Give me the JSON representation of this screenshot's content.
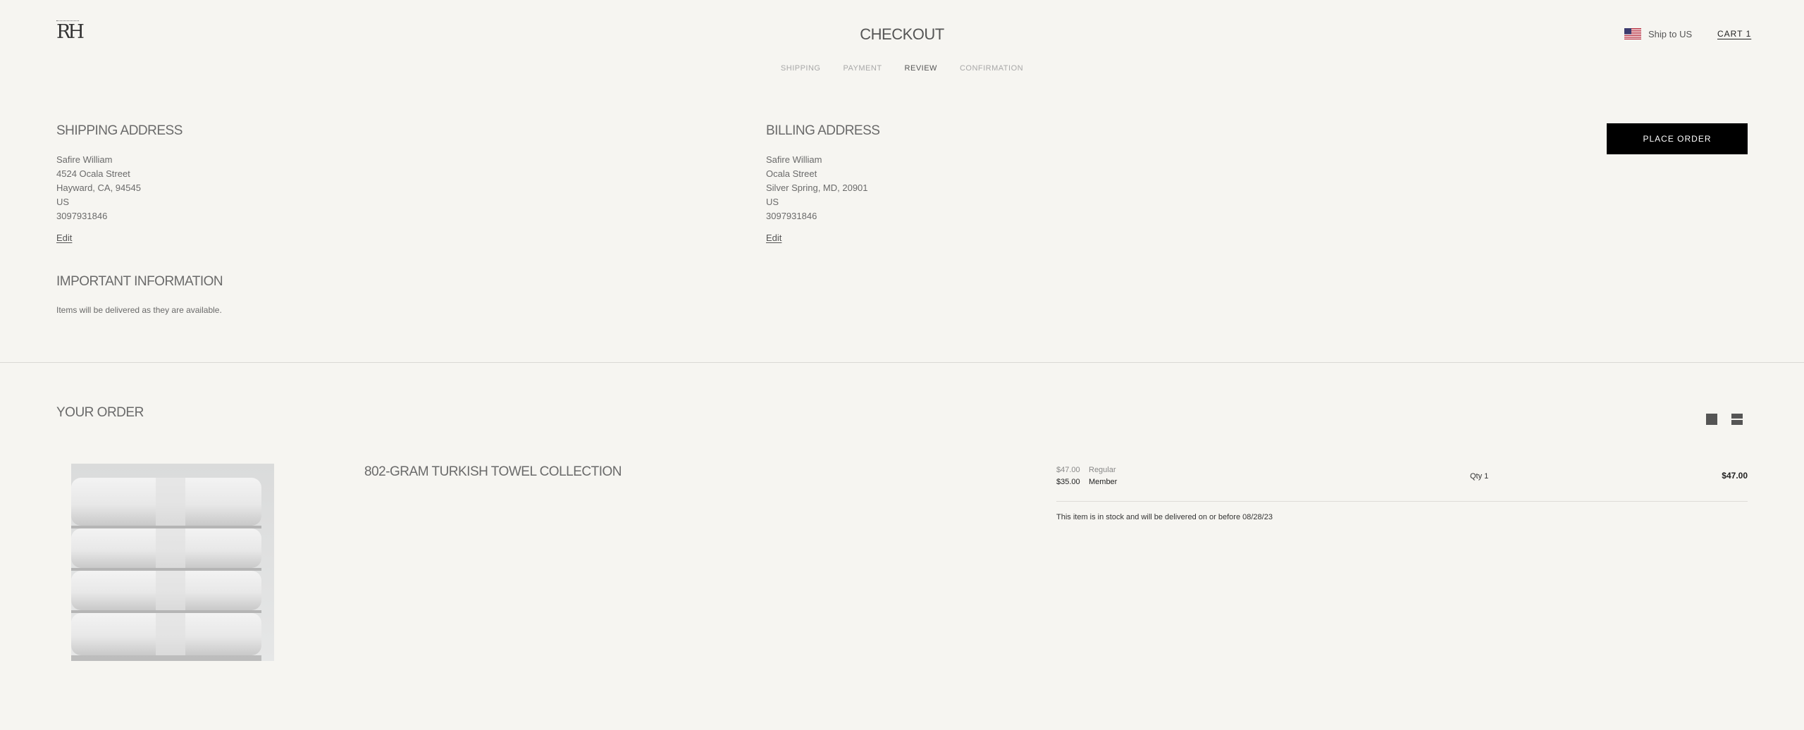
{
  "header": {
    "logo_text": "RH",
    "title": "CHECKOUT",
    "ship_to": "Ship to US",
    "cart": "CART 1"
  },
  "steps": [
    {
      "label": "SHIPPING",
      "active": false
    },
    {
      "label": "PAYMENT",
      "active": false
    },
    {
      "label": "REVIEW",
      "active": true
    },
    {
      "label": "CONFIRMATION",
      "active": false
    }
  ],
  "shipping": {
    "heading": "SHIPPING ADDRESS",
    "lines": [
      "Safire William",
      "4524 Ocala Street",
      "Hayward, CA, 94545",
      "US",
      "3097931846"
    ],
    "edit": "Edit"
  },
  "billing": {
    "heading": "BILLING ADDRESS",
    "lines": [
      "Safire William",
      "Ocala Street",
      "Silver Spring, MD, 20901",
      "US",
      "3097931846"
    ],
    "edit": "Edit"
  },
  "place_order": "PLACE ORDER",
  "important": {
    "heading": "IMPORTANT INFORMATION",
    "text": "Items will be delivered as they are available."
  },
  "order": {
    "heading": "YOUR ORDER",
    "view_icons": [
      "grid-view-icon",
      "list-view-icon"
    ],
    "item": {
      "name": "802-GRAM TURKISH TOWEL COLLECTION",
      "image": "towel-stack-image",
      "regular_price": "$47.00",
      "regular_label": "Regular",
      "member_price": "$35.00",
      "member_label": "Member",
      "qty": "Qty 1",
      "total": "$47.00",
      "stock_message": "This item is in stock and will be delivered on or before 08/28/23"
    }
  },
  "colors": {
    "background": "#f6f5f1",
    "button": "#000000",
    "text": "#4a4a4a"
  }
}
